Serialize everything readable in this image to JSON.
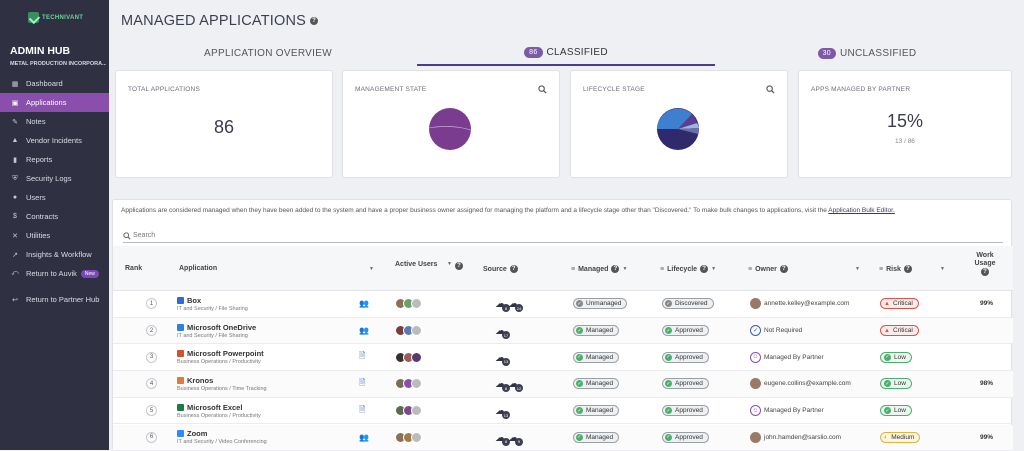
{
  "brand": {
    "name": "TECHNIVANT",
    "accent": "#8a4fad"
  },
  "sidebar": {
    "title": "ADMIN HUB",
    "org": "METAL PRODUCTION INCORPORA...",
    "items": [
      {
        "label": "Dashboard",
        "icon": "dashboard-icon"
      },
      {
        "label": "Applications",
        "icon": "applications-icon",
        "active": true
      },
      {
        "label": "Notes",
        "icon": "notes-icon"
      },
      {
        "label": "Vendor Incidents",
        "icon": "warning-icon"
      },
      {
        "label": "Reports",
        "icon": "bar-chart-icon"
      },
      {
        "label": "Security Logs",
        "icon": "shield-icon"
      },
      {
        "label": "Users",
        "icon": "user-icon"
      },
      {
        "label": "Contracts",
        "icon": "dollar-icon"
      },
      {
        "label": "Utilities",
        "icon": "tools-icon"
      },
      {
        "label": "Insights & Workflow",
        "icon": "insights-icon"
      },
      {
        "label": "Return to Auvik",
        "icon": "return-icon",
        "badge": "New"
      }
    ],
    "bottom": {
      "label": "Return to Partner Hub"
    }
  },
  "page": {
    "title": "MANAGED APPLICATIONS"
  },
  "tabs": [
    {
      "label": "APPLICATION OVERVIEW"
    },
    {
      "label": "CLASSIFIED",
      "count": "86"
    },
    {
      "label": "UNCLASSIFIED",
      "count": "30"
    }
  ],
  "cards": {
    "total": {
      "title": "TOTAL APPLICATIONS",
      "value": "86"
    },
    "management": {
      "title": "MANAGEMENT STATE"
    },
    "lifecycle": {
      "title": "LIFECYCLE STAGE"
    },
    "partner": {
      "title": "APPS MANAGED BY PARTNER",
      "value": "15%",
      "sub": "13 / 86"
    }
  },
  "info": {
    "text": "Applications are considered managed when they have been added to the system and have a proper business owner assigned for managing the platform and a lifecycle stage other than \"Discovered.\" To make bulk changes to applications, visit the",
    "link": "Application Bulk Editor."
  },
  "search": {
    "placeholder": "Search"
  },
  "columns": {
    "rank": "Rank",
    "application": "Application",
    "active_users": "Active Users",
    "source": "Source",
    "managed": "Managed",
    "lifecycle": "Lifecycle",
    "owner": "Owner",
    "risk": "Risk",
    "work_usage_1": "Work",
    "work_usage_2": "Usage"
  },
  "rows": [
    {
      "rank": "1",
      "name": "Box",
      "category": "IT and Security / File Sharing",
      "icon_color": "#2a6fd6",
      "users": "4",
      "src": [
        "8",
        "24"
      ],
      "managed": "Unmanaged",
      "lifecycle": "Discovered",
      "owner": "annette.kelley@example.com",
      "risk": "Critical",
      "usage": "99%"
    },
    {
      "rank": "2",
      "name": "Microsoft OneDrive",
      "category": "IT and Security / File Sharing",
      "icon_color": "#2a85d8",
      "users": "1",
      "src": [
        "17"
      ],
      "managed": "Managed",
      "lifecycle": "Approved",
      "owner": "Not Required",
      "risk": "Critical",
      "usage": ""
    },
    {
      "rank": "3",
      "name": "Microsoft Powerpoint",
      "category": "Business Operations / Productivity",
      "icon_color": "#d2502a",
      "users": "",
      "src": [
        "13"
      ],
      "managed": "Managed",
      "lifecycle": "Approved",
      "owner": "Managed By Partner",
      "risk": "Low",
      "usage": ""
    },
    {
      "rank": "4",
      "name": "Kronos",
      "category": "Business Operations / Time Tracking",
      "icon_color": "#e07a3a",
      "users": "",
      "src": [
        "8",
        "12"
      ],
      "managed": "Managed",
      "lifecycle": "Approved",
      "owner": "eugene.collins@example.com",
      "risk": "Low",
      "usage": "98%"
    },
    {
      "rank": "5",
      "name": "Microsoft Excel",
      "category": "Business Operations / Productivity",
      "icon_color": "#1f7a45",
      "users": "",
      "src": [
        "13"
      ],
      "managed": "Managed",
      "lifecycle": "Approved",
      "owner": "Managed By Partner",
      "risk": "Low",
      "usage": ""
    },
    {
      "rank": "6",
      "name": "Zoom",
      "category": "IT and Security / Video Conferencing",
      "icon_color": "#2d8cff",
      "users": "3",
      "src": [
        "8",
        "9"
      ],
      "managed": "Managed",
      "lifecycle": "Approved",
      "owner": "john.hamden@sarslio.com",
      "risk": "Medium",
      "usage": "99%"
    }
  ]
}
